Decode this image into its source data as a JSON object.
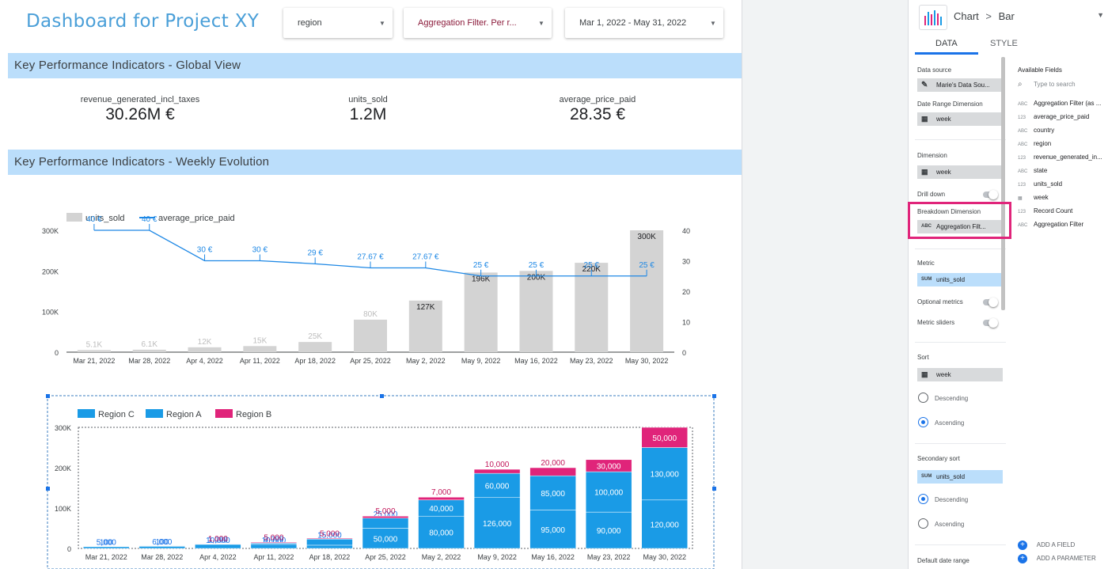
{
  "report": {
    "title": "Dashboard for Project XY",
    "controls": {
      "region": "region",
      "aggregation": "Aggregation Filter. Per r...",
      "date_range": "Mar 1, 2022 - May 31, 2022"
    },
    "sections": {
      "global": "Key Performance Indicators - Global View",
      "weekly": "Key Performance Indicators - Weekly Evolution"
    },
    "kpis": [
      {
        "name": "revenue_generated_incl_taxes",
        "value": "30.26M €"
      },
      {
        "name": "units_sold",
        "value": "1.2M"
      },
      {
        "name": "average_price_paid",
        "value": "28.35 €"
      }
    ]
  },
  "chart_data": [
    {
      "type": "bar",
      "title": "",
      "categories": [
        "Mar 21, 2022",
        "Mar 28, 2022",
        "Apr 4, 2022",
        "Apr 11, 2022",
        "Apr 18, 2022",
        "Apr 25, 2022",
        "May 2, 2022",
        "May 9, 2022",
        "May 16, 2022",
        "May 23, 2022",
        "May 30, 2022"
      ],
      "series": [
        {
          "name": "units_sold",
          "type": "bar",
          "axis": "left",
          "color": "#d3d3d3",
          "values": [
            5100,
            6100,
            12000,
            15000,
            25000,
            80000,
            127000,
            196000,
            200000,
            220000,
            300000
          ],
          "labels": [
            "5.1K",
            "6.1K",
            "12K",
            "15K",
            "25K",
            "80K",
            "127K",
            "196K",
            "200K",
            "220K",
            "300K"
          ]
        },
        {
          "name": "average_price_paid",
          "type": "line",
          "axis": "right",
          "color": "#1e88e5",
          "values": [
            40,
            40,
            30,
            30,
            29,
            27.67,
            27.67,
            25,
            25,
            25,
            25
          ],
          "labels": [
            "40 €",
            "40 €",
            "30 €",
            "30 €",
            "29 €",
            "27.67 €",
            "27.67 €",
            "25 €",
            "25 €",
            "25 €",
            "25 €"
          ]
        }
      ],
      "y_left": {
        "ticks": [
          "0",
          "100K",
          "200K",
          "300K"
        ],
        "range": [
          0,
          300000
        ]
      },
      "y_right": {
        "ticks": [
          "0",
          "10",
          "20",
          "30",
          "40"
        ],
        "range": [
          0,
          40
        ]
      },
      "legend": "top-left"
    },
    {
      "type": "bar",
      "stacked": true,
      "title": "",
      "categories": [
        "Mar 21, 2022",
        "Mar 28, 2022",
        "Apr 4, 2022",
        "Apr 11, 2022",
        "Apr 18, 2022",
        "Apr 25, 2022",
        "May 2, 2022",
        "May 9, 2022",
        "May 16, 2022",
        "May 23, 2022",
        "May 30, 2022"
      ],
      "series": [
        {
          "name": "Region C",
          "color": "#1a9be6",
          "values": [
            5000,
            6000,
            10000,
            10000,
            8000,
            50000,
            80000,
            126000,
            95000,
            90000,
            120000
          ]
        },
        {
          "name": "Region A",
          "color": "#1a9be6",
          "values": [
            100,
            100,
            1000,
            3000,
            15000,
            25000,
            40000,
            60000,
            85000,
            100000,
            130000
          ]
        },
        {
          "name": "Region B",
          "color": "#e0247a",
          "values": [
            0,
            0,
            1000,
            2000,
            2000,
            5000,
            7000,
            10000,
            20000,
            30000,
            50000
          ]
        }
      ],
      "point_labels": [
        [
          "5,000",
          "100",
          ""
        ],
        [
          "6,000",
          "100",
          ""
        ],
        [
          "10,000",
          "1,000",
          "1,000"
        ],
        [
          "10,000",
          "3,000",
          "5,000"
        ],
        [
          "8",
          "15,000",
          "5,000"
        ],
        [
          "50,000",
          "25,000",
          "5,000"
        ],
        [
          "80,000",
          "40,000",
          "7,000"
        ],
        [
          "126,000",
          "60,000",
          "10,000"
        ],
        [
          "95,000",
          "85,000",
          "20,000"
        ],
        [
          "90,000",
          "100,000",
          "30,000"
        ],
        [
          "120,000",
          "130,000",
          "50,000"
        ]
      ],
      "y": {
        "ticks": [
          "0",
          "100K",
          "200K",
          "300K"
        ],
        "range": [
          0,
          300000
        ]
      },
      "legend": "top-left"
    }
  ],
  "panel": {
    "breadcrumb": "Chart",
    "breadcrumb_sep": ">",
    "chart_type": "Bar",
    "tabs": [
      "DATA",
      "STYLE"
    ],
    "data_source_label": "Data source",
    "data_source_value": "Marie's Data Sou...",
    "date_range_dim_label": "Date Range Dimension",
    "date_range_dim_value": "week",
    "dimension_label": "Dimension",
    "dimension_value": "week",
    "drill_down": "Drill down",
    "breakdown_label": "Breakdown Dimension",
    "breakdown_value": "Aggregation Filt...",
    "metric_label": "Metric",
    "metric_value": "units_sold",
    "optional_metrics": "Optional metrics",
    "metric_sliders": "Metric sliders",
    "sort_label": "Sort",
    "sort_value": "week",
    "descending": "Descending",
    "ascending": "Ascending",
    "secondary_sort_label": "Secondary sort",
    "secondary_sort_value": "units_sold",
    "default_date_range": "Default date range",
    "available_fields_label": "Available Fields",
    "search_placeholder": "Type to search",
    "fields": [
      {
        "type": "ABC",
        "name": "Aggregation Filter (as ..."
      },
      {
        "type": "123",
        "name": "average_price_paid"
      },
      {
        "type": "ABC",
        "name": "country"
      },
      {
        "type": "ABC",
        "name": "region"
      },
      {
        "type": "123",
        "name": "revenue_generated_in..."
      },
      {
        "type": "ABC",
        "name": "state"
      },
      {
        "type": "123",
        "name": "units_sold"
      },
      {
        "type": "cal",
        "name": "week"
      },
      {
        "type": "123",
        "name": "Record Count"
      },
      {
        "type": "ABC",
        "name": "Aggregation Filter"
      }
    ],
    "add_field": "ADD A FIELD",
    "add_parameter": "ADD A PARAMETER",
    "icons": {
      "calendar": "calendar-icon",
      "pencil": "pencil-icon",
      "search": "search-icon",
      "add": "add-circle-icon"
    }
  }
}
